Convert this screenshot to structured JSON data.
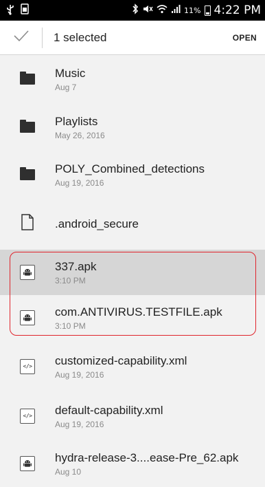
{
  "status_bar": {
    "battery_text": "11%",
    "time": "4:22 PM",
    "icons": [
      "usb-icon",
      "screenshot-icon",
      "bluetooth-icon",
      "mute-icon",
      "wifi-icon",
      "signal-icon",
      "battery-icon"
    ]
  },
  "action_bar": {
    "selected_text": "1 selected",
    "open_label": "OPEN"
  },
  "files": [
    {
      "name": "Music",
      "date": "Aug 7",
      "icon": "folder-icon",
      "selected": false
    },
    {
      "name": "Playlists",
      "date": "May 26, 2016",
      "icon": "folder-icon",
      "selected": false
    },
    {
      "name": "POLY_Combined_detections",
      "date": "Aug 19, 2016",
      "icon": "folder-icon",
      "selected": false
    },
    {
      "name": ".android_secure",
      "date": "",
      "icon": "file-icon",
      "selected": false
    },
    {
      "name": "337.apk",
      "date": "3:10 PM",
      "icon": "android-apk-icon",
      "selected": true
    },
    {
      "name": "com.ANTIVIRUS.TESTFILE.apk",
      "date": "3:10 PM",
      "icon": "android-apk-icon",
      "selected": false
    },
    {
      "name": "customized-capability.xml",
      "date": "Aug 19, 2016",
      "icon": "xml-file-icon",
      "selected": false
    },
    {
      "name": "default-capability.xml",
      "date": "Aug 19, 2016",
      "icon": "xml-file-icon",
      "selected": false
    },
    {
      "name": "hydra-release-3....ease-Pre_62.apk",
      "date": "Aug 10",
      "icon": "android-apk-icon",
      "selected": false
    }
  ],
  "colors": {
    "highlight": "#d6d6d6",
    "annotation_frame": "#e0232b"
  }
}
